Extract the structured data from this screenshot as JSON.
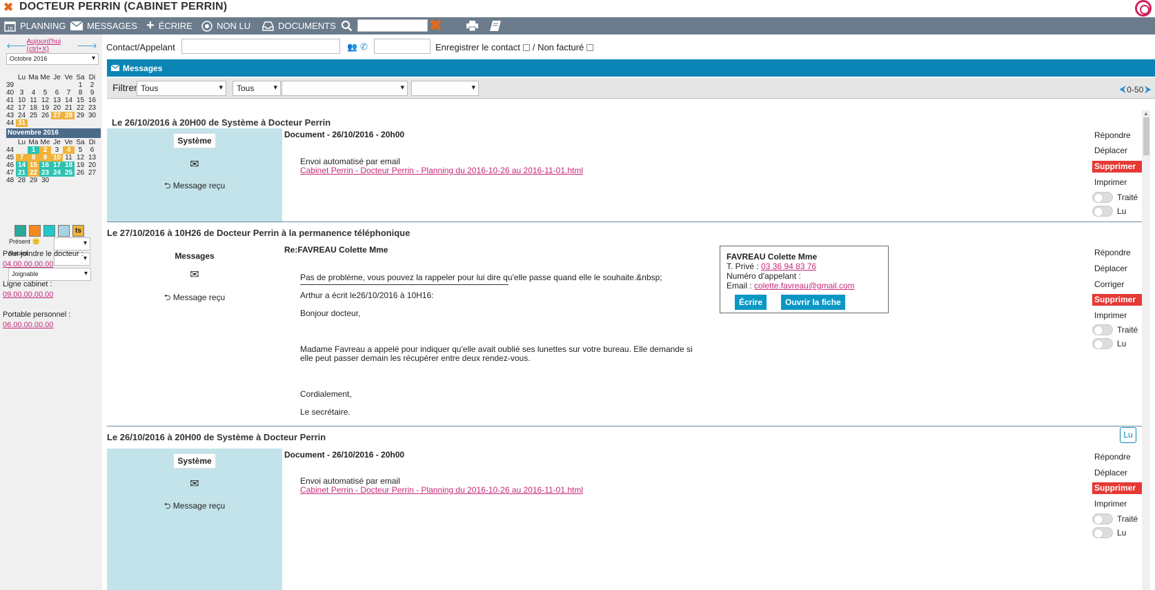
{
  "window": {
    "title": "DOCTEUR PERRIN (CABINET PERRIN)"
  },
  "toolbar": {
    "planning": "PLANNING",
    "planning_day": "16",
    "messages": "MESSAGES",
    "ecrire": "ÉCRIRE",
    "non_lu": "NON LU",
    "documents": "DOCUMENTS",
    "search_value": ""
  },
  "sidebar": {
    "today_link": "Aujourd'hui (ctrl+X)",
    "month_select": "Octobre 2016",
    "weekdays": [
      "Lu",
      "Ma",
      "Me",
      "Je",
      "Ve",
      "Sa",
      "Di"
    ],
    "october": [
      {
        "wk": "39",
        "days": [
          "",
          "",
          "",
          "",
          "",
          "1",
          "2"
        ]
      },
      {
        "wk": "40",
        "days": [
          "3",
          "4",
          "5",
          "6",
          "7",
          "8",
          "9"
        ]
      },
      {
        "wk": "41",
        "days": [
          "10",
          "11",
          "12",
          "13",
          "14",
          "15",
          "16"
        ]
      },
      {
        "wk": "42",
        "days": [
          "17",
          "18",
          "19",
          "20",
          "21",
          "22",
          "23"
        ]
      },
      {
        "wk": "43",
        "days": [
          "24",
          "25",
          "26",
          "27",
          "28",
          "29",
          "30"
        ]
      },
      {
        "wk": "44",
        "days": [
          "31",
          "",
          "",
          "",
          "",
          "",
          ""
        ]
      }
    ],
    "november_title": "Novembre 2016",
    "november": [
      {
        "wk": "44",
        "days": [
          "",
          "1",
          "2",
          "3",
          "4",
          "5",
          "6"
        ]
      },
      {
        "wk": "45",
        "days": [
          "7",
          "8",
          "9",
          "10",
          "11",
          "12",
          "13"
        ]
      },
      {
        "wk": "46",
        "days": [
          "14",
          "15",
          "16",
          "17",
          "18",
          "19",
          "20"
        ]
      },
      {
        "wk": "47",
        "days": [
          "21",
          "22",
          "23",
          "24",
          "25",
          "26",
          "27"
        ]
      },
      {
        "wk": "48",
        "days": [
          "28",
          "29",
          "30",
          "",
          "",
          "",
          ""
        ]
      }
    ],
    "legend_colors": [
      "#2aa89b",
      "#f58a1f",
      "#23c9c9",
      "#a9d3e2",
      "#f0b23a"
    ],
    "legend_ts": "ts",
    "present_label": "Présent",
    "retard_label": "Retard",
    "joignable": "Joignable",
    "pour_joindre": "Pour joindre le docteur :",
    "pour_joindre_num": "04.00.00.00.00",
    "ligne_cabinet": "Ligne cabinet :",
    "ligne_cabinet_num": "09.00.00.00.00",
    "portable": "Portable personnel :",
    "portable_num": "06.00.00.00.00"
  },
  "contact_row": {
    "label": "Contact/Appelant",
    "enregistrer": "Enregistrer le contact",
    "non_facture": "/ Non facturé"
  },
  "messages_panel": {
    "title": "Messages",
    "filter_label": "Filtrer",
    "filter1": "Tous",
    "filter2": "Tous",
    "filter3": "",
    "filter4": "",
    "pager": "0-50"
  },
  "messages": [
    {
      "header": "Le 26/10/2016 à 20H00 de Système à Docteur Perrin",
      "sender": "Système",
      "status": "Message reçu",
      "subject": "Document - 26/10/2016 - 20h00",
      "body": "Envoi automatisé par email",
      "link": "Cabinet Perrin - Docteur Perrin - Planning du 2016-10-26 au 2016-11-01.html"
    },
    {
      "header": "Le 27/10/2016 à 10H26 de Docteur Perrin à la permanence téléphonique",
      "sender": "Messages",
      "status": "Message reçu",
      "subject": "Re:FAVREAU Colette Mme",
      "body_lines": [
        "Pas de problème, vous pouvez la rappeler pour lui dire qu'elle passe quand elle le souhaite.&nbsp;",
        "Arthur a écrit le26/10/2016 à 10H16:",
        "Bonjour docteur,",
        "Madame Favreau a appelé pour indiquer qu'elle avait oublié ses lunettes sur votre bureau. Elle demande si",
        "elle peut passer demain les récupérer entre deux rendez-vous.",
        "Cordialement,",
        "Le secrétaire."
      ],
      "contact": {
        "name": "FAVREAU Colette Mme",
        "prive_label": "T. Privé :",
        "prive": "03 36 94 83 76",
        "appelant_label": "Numéro d'appelant :",
        "email_label": "Email :",
        "email": "colette.favreau@gmail.com",
        "ecrire": "Écrire",
        "ouvrir": "Ouvrir la fiche"
      }
    },
    {
      "header": "Le 26/10/2016 à 20H00 de Système à Docteur Perrin",
      "sender": "Système",
      "status": "Message reçu",
      "subject": "Document - 26/10/2016 - 20h00",
      "body": "Envoi automatisé par email",
      "link": "Cabinet Perrin - Docteur Perrin - Planning du 2016-10-26 au 2016-11-01.html",
      "lu_button": "Lu"
    }
  ],
  "actions": {
    "repondre": "Répondre",
    "deplacer": "Déplacer",
    "corriger": "Corriger",
    "supprimer": "Supprimer",
    "imprimer": "Imprimer",
    "traite": "Traité",
    "lu": "Lu"
  }
}
